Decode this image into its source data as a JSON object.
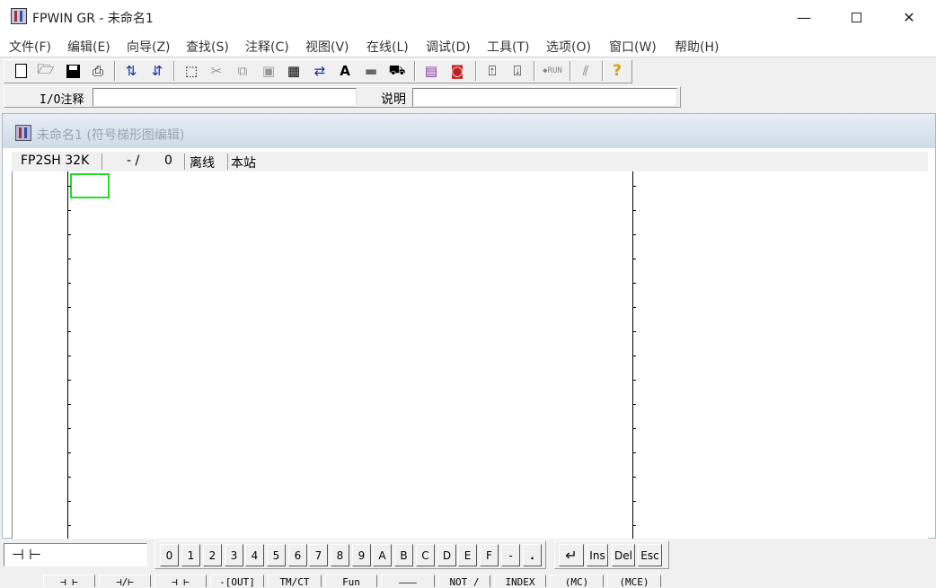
{
  "window": {
    "title": "FPWIN GR - 未命名1"
  },
  "menu": [
    "文件(F)",
    "编辑(E)",
    "向导(Z)",
    "查找(S)",
    "注释(C)",
    "视图(V)",
    "在线(L)",
    "调试(D)",
    "工具(T)",
    "选项(O)",
    "窗口(W)",
    "帮助(H)"
  ],
  "toolbar": {
    "icons": [
      "new-file-icon",
      "open-folder-icon",
      "save-icon",
      "print-icon",
      "ladder-up-icon",
      "ladder-down-icon",
      "select-icon",
      "cut-icon",
      "copy-icon",
      "paste-icon",
      "register-icon",
      "transfer-icon",
      "text-icon",
      "block-icon",
      "find-icon",
      "monitor-icon",
      "compare-icon",
      "plc-read-icon",
      "plc-write-icon",
      "run-icon",
      "force-icon",
      "help-icon"
    ],
    "text_a": "A",
    "run_label": "◆RUN",
    "help_glyph": "?"
  },
  "comment_bar": {
    "io_label": "I/O注释",
    "io_value": "",
    "desc_label": "说明",
    "desc_value": ""
  },
  "child_window": {
    "title": "未命名1 (符号梯形图编辑)",
    "plc_model": "FP2SH 32K",
    "address": "- /",
    "step": "0",
    "mode": "离线",
    "station": "本站"
  },
  "palette": {
    "instruction": "⊣ ⊢",
    "keys": [
      "0",
      "1",
      "2",
      "3",
      "4",
      "5",
      "6",
      "7",
      "8",
      "9",
      "A",
      "B",
      "C",
      "D",
      "E",
      "F",
      "-",
      "."
    ],
    "enter": "↵",
    "ins": "Ins",
    "del": "Del",
    "esc": "Esc",
    "fkeys": [
      "⊣ ⊢",
      "⊣/⊢",
      "⊣  ⊢",
      "-[OUT]",
      "TM/CT",
      "Fun",
      "———",
      "NOT /",
      "INDEX",
      "(MC)",
      "(MCE)"
    ]
  }
}
